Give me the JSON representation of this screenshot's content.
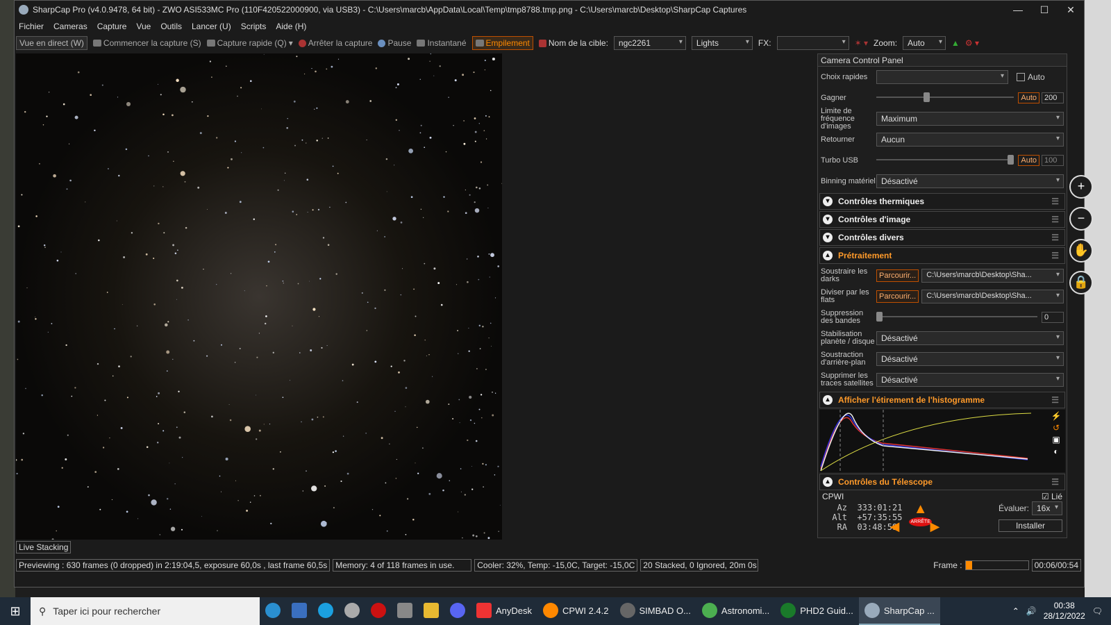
{
  "window": {
    "title": "SharpCap Pro (v4.0.9478, 64 bit) - ZWO ASI533MC Pro (110F420522000900, via USB3) - C:\\Users\\marcb\\AppData\\Local\\Temp\\tmp8788.tmp.png - C:\\Users\\marcb\\Desktop\\SharpCap Captures",
    "minimize": "—",
    "maximize": "☐",
    "close": "✕"
  },
  "menu": [
    "Fichier",
    "Cameras",
    "Capture",
    "Vue",
    "Outils",
    "Lancer (U)",
    "Scripts",
    "Aide (H)"
  ],
  "toolbar": {
    "live": "Vue en direct (W)",
    "start_capture": "Commencer la capture (S)",
    "quick_capture": "Capture rapide (Q)",
    "stop_capture": "Arrêter la capture",
    "pause": "Pause",
    "snapshot": "Instantané",
    "stacking": "Empilement",
    "target_label": "Nom de la cible:",
    "target_value": "ngc2261",
    "frame_type": "Lights",
    "fx_label": "FX:",
    "fx_value": "",
    "zoom_label": "Zoom:",
    "zoom_value": "Auto"
  },
  "panel": {
    "title": "Camera Control Panel",
    "quick_choice_label": "Choix rapides",
    "quick_choice_value": "",
    "auto_check": "Auto",
    "gain_label": "Gagner",
    "gain_auto": "Auto",
    "gain_value": "200",
    "gain_level": 0.36,
    "frame_rate_label": "Limite de fréquence d'images",
    "frame_rate_value": "Maximum",
    "flip_label": "Retourner",
    "flip_value": "Aucun",
    "usb_label": "Turbo USB",
    "usb_auto": "Auto",
    "usb_value": "100",
    "usb_level": 1.0,
    "binning_label": "Binning matériel",
    "binning_value": "Désactivé",
    "sections": [
      "Contrôles thermiques",
      "Contrôles d'image",
      "Contrôles divers"
    ],
    "preproc_title": "Prétraitement",
    "darks_label": "Soustraire les darks",
    "darks_browse": "Parcourir...",
    "darks_path": "C:\\Users\\marcb\\Desktop\\Sha...",
    "flats_label": "Diviser par les flats",
    "flats_browse": "Parcourir...",
    "flats_path": "C:\\Users\\marcb\\Desktop\\Sha...",
    "banding_label": "Suppression des bandes",
    "banding_value": "0",
    "banding_level": 0.0,
    "stab_label": "Stabilisation planète / disque",
    "stab_value": "Désactivé",
    "bg_label": "Soustraction d'arrière-plan",
    "bg_value": "Désactivé",
    "sat_label": "Supprimer les traces satellites",
    "sat_value": "Désactivé",
    "hist_title": "Afficher l'étirement de l'histogramme",
    "scope_title": "Contrôles du Télescope",
    "scope_name": "CPWI",
    "scope_linked": "Lié",
    "az_label": "Az",
    "az_value": "333:01:21",
    "alt_label": "Alt",
    "alt_value": "+57:35:55",
    "ra_label": "RA",
    "ra_value": "03:48:59",
    "rate_label": "Évaluer:",
    "rate_value": "16x",
    "install": "Installer",
    "stop_label": "ARRÊTE"
  },
  "live_stacking": "Live Stacking",
  "status": {
    "preview": "Previewing : 630 frames (0 dropped) in 2:19:04,5, exposure 60,0s , last frame 60,5s",
    "memory": "Memory: 4 of 118 frames in use.",
    "cooler": "Cooler: 32%, Temp: -15,0C, Target: -15,0C",
    "stacked": "20 Stacked, 0 Ignored, 20m 0s",
    "frame_label": "Frame :",
    "time": "00:06/00:54",
    "frame_progress": 0.11
  },
  "taskbar": {
    "search": "Taper ici pour rechercher",
    "apps": [
      "AnyDesk",
      "CPWI 2.4.2",
      "SIMBAD O...",
      "Astronomi...",
      "PHD2 Guid...",
      "SharpCap ..."
    ],
    "time": "00:38",
    "date": "28/12/2022"
  },
  "colors": {
    "accent": "#ff8a00",
    "bg": "#1b1b1b"
  }
}
